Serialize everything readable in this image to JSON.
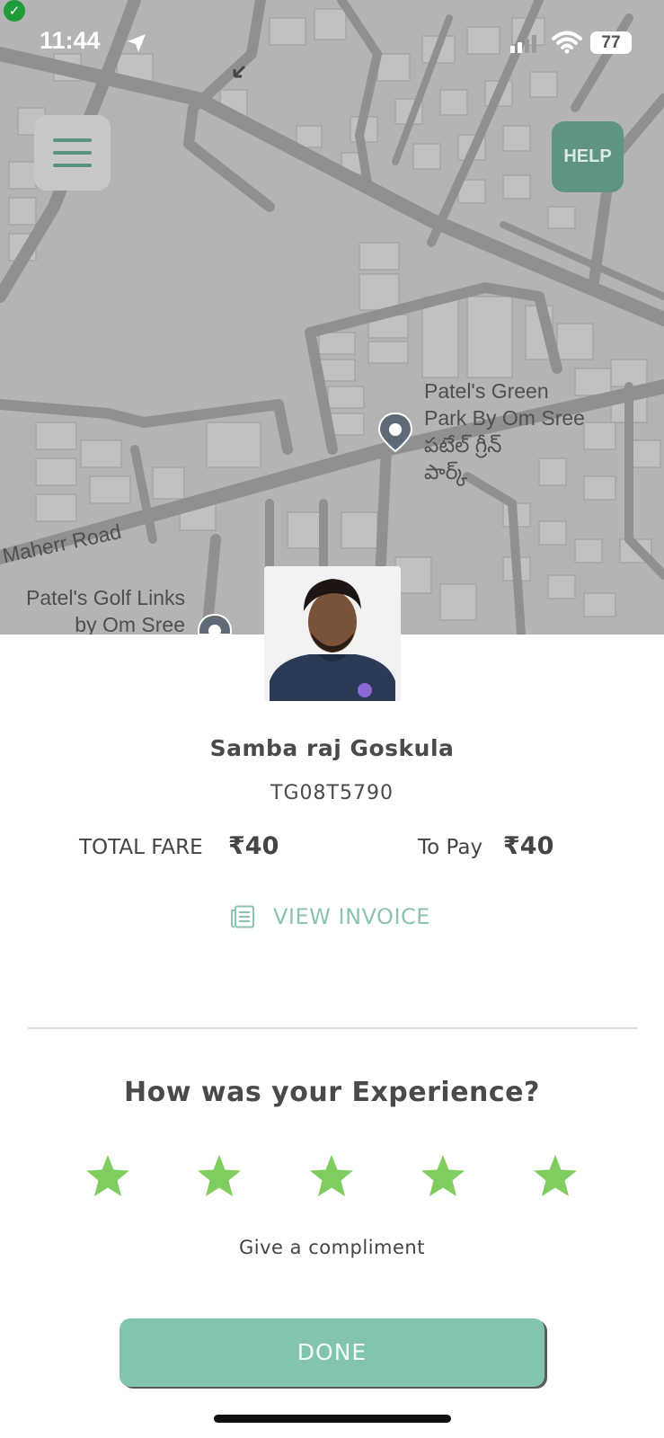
{
  "status_bar": {
    "time": "11:44",
    "battery": "77"
  },
  "map": {
    "help_label": "HELP",
    "place_name_lines": [
      "Patel's Green",
      "Park By Om Sree",
      "పటేల్ గ్రీన్",
      "పార్క్"
    ],
    "road_label": "Maherr Road",
    "place2_lines": [
      "Patel's Golf Links",
      "by Om Sree"
    ]
  },
  "driver": {
    "name": "Samba raj Goskula",
    "vehicle_number": "TG08T5790"
  },
  "fare": {
    "total_label": "TOTAL FARE",
    "total_value": "₹40",
    "to_pay_label": "To Pay",
    "to_pay_value": "₹40"
  },
  "invoice": {
    "label": "VIEW INVOICE"
  },
  "rating": {
    "question": "How was your Experience?",
    "stars_selected": 5,
    "stars_total": 5,
    "compliment_label": "Give a compliment"
  },
  "actions": {
    "done_label": "DONE"
  },
  "colors": {
    "accent": "#82c4ad",
    "star": "#7fcc5f",
    "help": "#5f9480"
  }
}
